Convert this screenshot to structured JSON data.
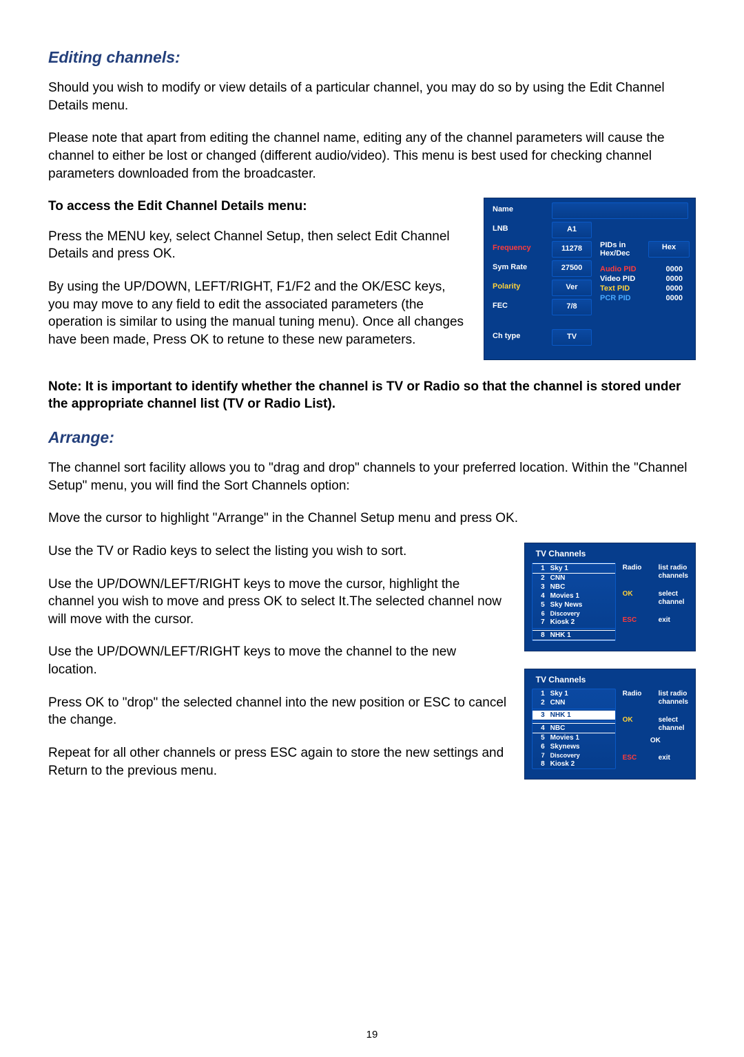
{
  "page_number": "19",
  "sections": {
    "editing_channels": {
      "heading": "Editing channels:",
      "p1": "Should you wish to modify or view details of a particular channel, you may do so by using the Edit Channel Details menu.",
      "p2": "Please note that apart from editing the channel name, editing any of the channel parameters will cause the channel to either be lost or changed (different audio/video). This menu is best used for checking channel parameters downloaded from the broadcaster.",
      "access_heading": "To access the Edit Channel Details menu:",
      "p3": "Press the MENU key, select Channel Setup, then select Edit Channel Details and press OK.",
      "p4": "By using the UP/DOWN, LEFT/RIGHT, F1/F2 and the OK/ESC keys, you may move to any field to edit the associated parameters (the operation is similar to using the manual tuning menu). Once all changes have been made, Press OK to retune to these new parameters.",
      "note": "Note: It is important to identify whether the channel is TV or Radio so that the channel is stored under the appropriate channel list (TV or Radio List)."
    },
    "arrange": {
      "heading": "Arrange:",
      "p1": "The channel sort facility allows you to \"drag and drop\" channels to your preferred location. Within the \"Channel Setup\" menu, you will find the Sort Channels option:",
      "p2": "Move the cursor to highlight \"Arrange\" in the Channel Setup menu and press OK.",
      "p3": "Use the TV or Radio keys to select the listing you wish to sort.",
      "p4": "Use the UP/DOWN/LEFT/RIGHT keys to move the cursor, highlight the channel you wish to move and press OK to select It.The selected channel now will move with the cursor.",
      "p5": "Use the UP/DOWN/LEFT/RIGHT keys to move the channel to the new location.",
      "p6": "Press OK to \"drop\" the selected channel into the new position or ESC to cancel the change.",
      "p7": "Repeat for all other channels or press ESC again to store the new settings and Return to the previous menu."
    }
  },
  "ecd": {
    "name_label": "Name",
    "lnb_label": "LNB",
    "frequency_label": "Frequency",
    "symrate_label": "Sym Rate",
    "polarity_label": "Polarity",
    "fec_label": "FEC",
    "chtype_label": "Ch type",
    "lnb_value": "A1",
    "frequency_value": "11278",
    "symrate_value": "27500",
    "polarity_value": "Ver",
    "fec_value": "7/8",
    "chtype_value": "TV",
    "pids_in_label": "PIDs in Hex/Dec",
    "hex_label": "Hex",
    "audio_pid_label": "Audio PID",
    "video_pid_label": "Video PID",
    "text_pid_label": "Text  PID",
    "pcr_pid_label": "PCR  PID",
    "audio_pid_value": "0000",
    "video_pid_value": "0000",
    "text_pid_value": "0000",
    "pcr_pid_value": "0000"
  },
  "tv1": {
    "title": "TV Channels",
    "items": [
      {
        "num": "1",
        "name": "Sky 1"
      },
      {
        "num": "2",
        "name": "CNN"
      },
      {
        "num": "3",
        "name": "NBC"
      },
      {
        "num": "4",
        "name": "Movies 1"
      },
      {
        "num": "5",
        "name": "Sky News"
      },
      {
        "num": "6",
        "name": "Discovery"
      },
      {
        "num": "7",
        "name": "Kiosk 2"
      },
      {
        "num": "8",
        "name": "NHK 1"
      }
    ],
    "side": {
      "radio_k": "Radio",
      "radio_v": "list radio channels",
      "ok_k": "OK",
      "ok_v": "select channel",
      "esc_k": "ESC",
      "esc_v": "exit"
    }
  },
  "tv2": {
    "title": "TV Channels",
    "items_before": [
      {
        "num": "1",
        "name": "Sky 1"
      },
      {
        "num": "2",
        "name": "CNN"
      }
    ],
    "selected": {
      "num": "3",
      "name": "NHK 1"
    },
    "items_after": [
      {
        "num": "4",
        "name": "NBC"
      },
      {
        "num": "5",
        "name": "Movies 1"
      },
      {
        "num": "6",
        "name": "Skynews"
      },
      {
        "num": "7",
        "name": "Discovery"
      },
      {
        "num": "8",
        "name": "Kiosk 2"
      }
    ],
    "side": {
      "radio_k": "Radio",
      "radio_v": "list radio channels",
      "ok_k": "OK",
      "ok_v": "select channel",
      "ok_center": "OK",
      "esc_k": "ESC",
      "esc_v": "exit"
    }
  }
}
